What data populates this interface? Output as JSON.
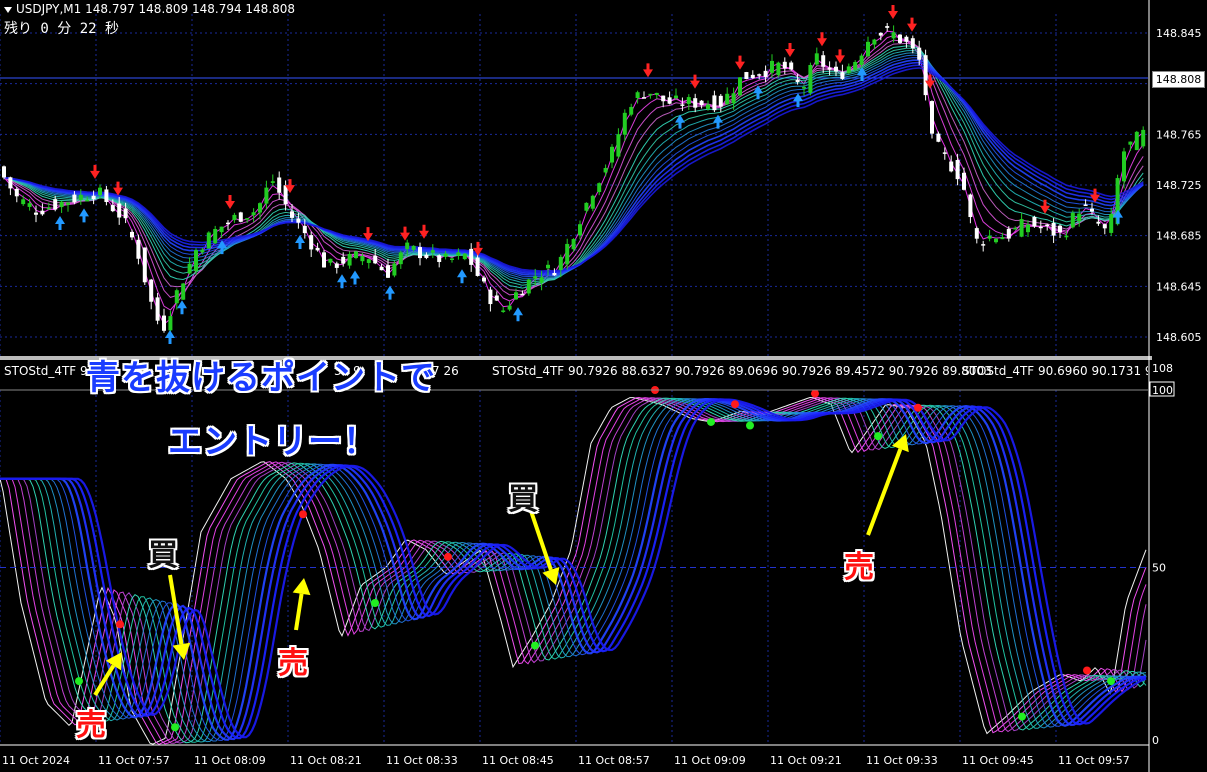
{
  "header": {
    "symbol_line": "USDJPY,M1  148.797 148.809 148.794 148.808",
    "remaining": "残り 0 分 22 秒"
  },
  "price_axis": {
    "labels": [
      "148.845",
      "148.805",
      "148.765",
      "148.725",
      "148.685",
      "148.645",
      "148.605"
    ],
    "current_price": "148.808"
  },
  "sub_window": {
    "labels": [
      {
        "text": "STOStd_4TF 9"
      },
      {
        "text": "34 9"
      },
      {
        "text": "7 26"
      },
      {
        "text": "STOStd_4TF 90.7926 88.6327 90.7926 89.0696 90.7926 89.4572 90.7926 89.8003"
      },
      {
        "text": "STOStd_4TF 90.6960 90.1731 90"
      }
    ],
    "axis_labels": [
      "108",
      "100",
      "50",
      "0"
    ]
  },
  "time_axis": {
    "labels": [
      "11 Oct 2024",
      "11 Oct 07:57",
      "11 Oct 08:09",
      "11 Oct 08:21",
      "11 Oct 08:33",
      "11 Oct 08:45",
      "11 Oct 08:57",
      "11 Oct 09:09",
      "11 Oct 09:21",
      "11 Oct 09:33",
      "11 Oct 09:45",
      "11 Oct 09:57"
    ]
  },
  "annotations": {
    "title_line1": "青を抜けるポイントで",
    "title_line2": "エントリー！",
    "sell1": "売",
    "buy1": "買",
    "sell2": "売",
    "buy2": "買",
    "sell3": "売"
  },
  "colors": {
    "background": "#000000",
    "grid": "#1a2a9a",
    "bull_candle": "#22cc22",
    "bear_candle": "#ffffff",
    "ribbon_magenta": "#ff33ff",
    "ribbon_teal": "#33ccaa",
    "ribbon_blue": "#2233ff",
    "sell_arrow": "#ff2222",
    "buy_arrow": "#2299ff",
    "annotation_blue": "#1a3cff",
    "annotation_red": "#ff1010",
    "arrow_yellow": "#ffff00"
  }
}
